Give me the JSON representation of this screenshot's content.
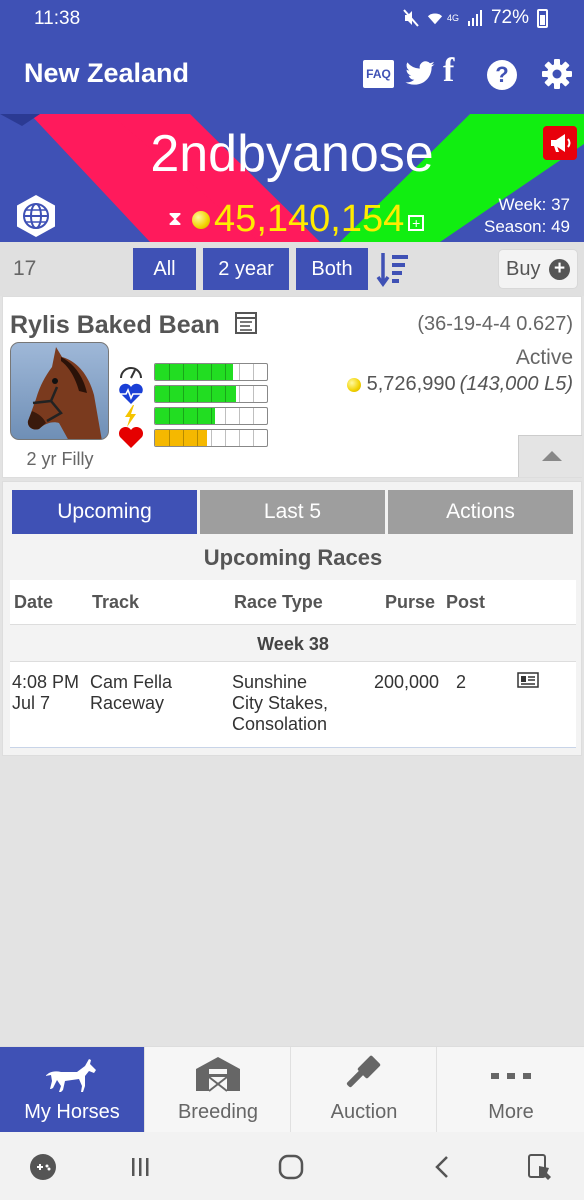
{
  "status_bar": {
    "time": "11:38",
    "network": "4G",
    "battery": "72%"
  },
  "app_bar": {
    "title": "New Zealand",
    "faq_label": "FAQ",
    "facebook_label": "f",
    "help_label": "?"
  },
  "banner": {
    "stable_name": "2ndbyanose",
    "balance": "45,140,154",
    "plus_label": "+",
    "week": "Week: 37",
    "season": "Season: 49",
    "colors": {
      "red": "#ff1a5c",
      "green": "#11ee11",
      "blue": "#3f51b5"
    }
  },
  "filter": {
    "count": "17",
    "buttons": [
      "All",
      "2 year",
      "Both"
    ],
    "buy_label": "Buy",
    "buy_plus": "+"
  },
  "horse": {
    "name": "Rylis Baked Bean",
    "record": "(36-19-4-4 0.627)",
    "status": "Active",
    "earnings": "5,726,990",
    "earnings_l5": "(143,000 L5)",
    "age": "2 yr Filly",
    "stats": [
      {
        "icon": "speedometer-icon",
        "level": 0.7,
        "color": "#22dd22"
      },
      {
        "icon": "heartbeat-icon",
        "level": 0.72,
        "color": "#22dd22"
      },
      {
        "icon": "lightning-icon",
        "level": 0.54,
        "color": "#22dd22"
      },
      {
        "icon": "heart-icon",
        "level": 0.46,
        "color": "#f5b800"
      }
    ]
  },
  "tabs": [
    {
      "label": "Upcoming",
      "active": true
    },
    {
      "label": "Last 5",
      "active": false
    },
    {
      "label": "Actions",
      "active": false
    }
  ],
  "upcoming": {
    "title": "Upcoming Races",
    "columns": [
      "Date",
      "Track",
      "Race Type",
      "Purse",
      "Post"
    ],
    "week_label": "Week 38",
    "rows": [
      {
        "date_line1": "4:08 PM",
        "date_line2": "Jul 7",
        "track_line1": "Cam Fella",
        "track_line2": "Raceway",
        "race_line1": "Sunshine",
        "race_line2": "City Stakes,",
        "race_line3": "Consolation",
        "purse": "200,000",
        "post": "2"
      }
    ]
  },
  "bottom_nav": [
    {
      "label": "My Horses",
      "icon": "horse-icon",
      "active": true
    },
    {
      "label": "Breeding",
      "icon": "barn-icon",
      "active": false
    },
    {
      "label": "Auction",
      "icon": "gavel-icon",
      "active": false
    },
    {
      "label": "More",
      "icon": "more-dots-icon",
      "active": false
    }
  ]
}
